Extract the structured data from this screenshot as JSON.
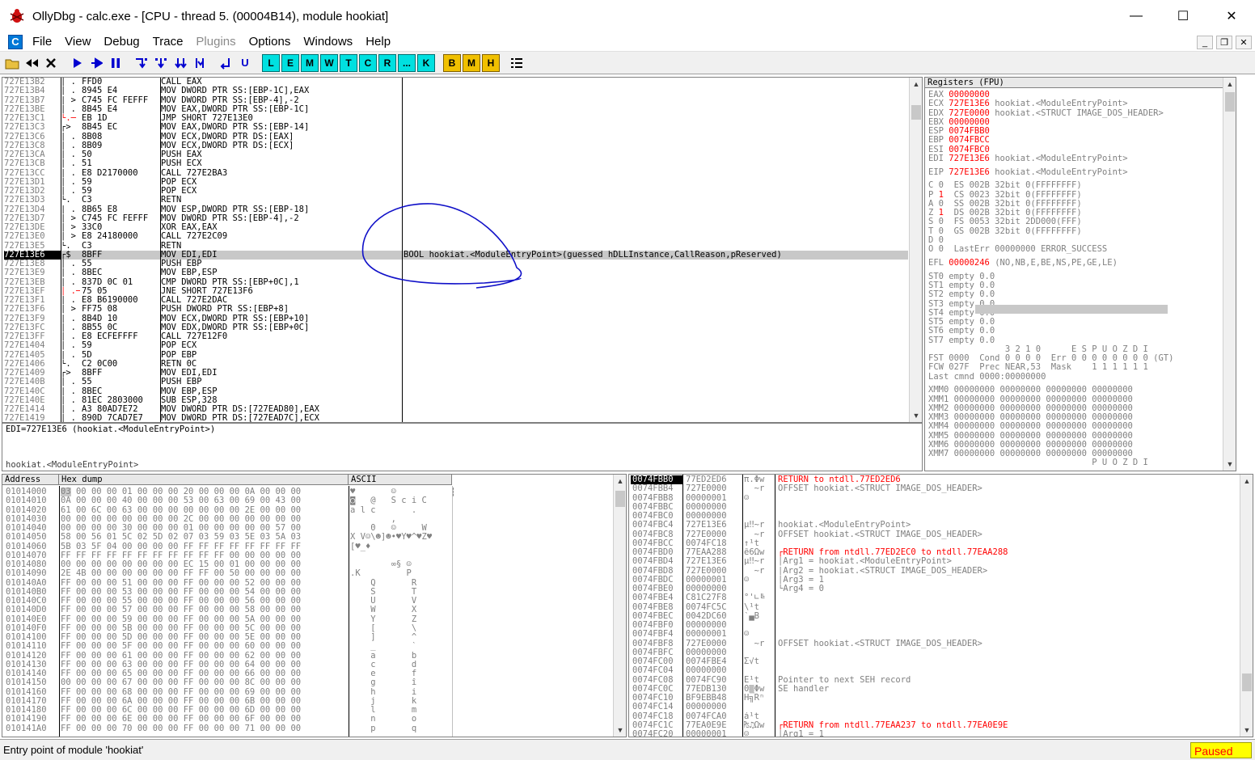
{
  "window": {
    "title": "OllyDbg - calc.exe - [CPU - thread 5. (00004B14), module hookiat]",
    "min": "—",
    "max": "☐",
    "close": "✕"
  },
  "menu": {
    "items": [
      {
        "label": "File",
        "enabled": true
      },
      {
        "label": "View",
        "enabled": true
      },
      {
        "label": "Debug",
        "enabled": true
      },
      {
        "label": "Trace",
        "enabled": true
      },
      {
        "label": "Plugins",
        "enabled": false
      },
      {
        "label": "Options",
        "enabled": true
      },
      {
        "label": "Windows",
        "enabled": true
      },
      {
        "label": "Help",
        "enabled": true
      }
    ]
  },
  "toolbar": {
    "letters": [
      "L",
      "E",
      "M",
      "W",
      "T",
      "C",
      "R",
      "...",
      "K"
    ],
    "letters2": [
      "B",
      "M",
      "H"
    ]
  },
  "disasm": {
    "selected_index": 19,
    "rows": [
      [
        "727E13B2",
        "│ .",
        "FFD0",
        "CALL EAX",
        ""
      ],
      [
        "727E13B4",
        "│ .",
        "8945 E4",
        "MOV DWORD PTR SS:[EBP-1C],EAX",
        ""
      ],
      [
        "727E13B7",
        "│ >",
        "C745 FC FEFFF",
        "MOV DWORD PTR SS:[EBP-4],-2",
        ""
      ],
      [
        "727E13BE",
        "│ .",
        "8B45 E4",
        "MOV EAX,DWORD PTR SS:[EBP-1C]",
        ""
      ],
      [
        "727E13C1",
        "└.─",
        "EB 1D",
        "JMP SHORT 727E13E0",
        ""
      ],
      [
        "727E13C3",
        "┌>",
        "8B45 EC",
        "MOV EAX,DWORD PTR SS:[EBP-14]",
        ""
      ],
      [
        "727E13C6",
        "│ .",
        "8B08",
        "MOV ECX,DWORD PTR DS:[EAX]",
        ""
      ],
      [
        "727E13C8",
        "│ .",
        "8B09",
        "MOV ECX,DWORD PTR DS:[ECX]",
        ""
      ],
      [
        "727E13CA",
        "│ .",
        "50",
        "PUSH EAX",
        ""
      ],
      [
        "727E13CB",
        "│ .",
        "51",
        "PUSH ECX",
        ""
      ],
      [
        "727E13CC",
        "│ .",
        "E8 D2170000",
        "CALL 727E2BA3",
        ""
      ],
      [
        "727E13D1",
        "│ .",
        "59",
        "POP ECX",
        ""
      ],
      [
        "727E13D2",
        "│ .",
        "59",
        "POP ECX",
        ""
      ],
      [
        "727E13D3",
        "└.",
        "C3",
        "RETN",
        ""
      ],
      [
        "727E13D4",
        "│ .",
        "8B65 E8",
        "MOV ESP,DWORD PTR SS:[EBP-18]",
        ""
      ],
      [
        "727E13D7",
        "│ >",
        "C745 FC FEFFF",
        "MOV DWORD PTR SS:[EBP-4],-2",
        ""
      ],
      [
        "727E13DE",
        "│ >",
        "33C0",
        "XOR EAX,EAX",
        ""
      ],
      [
        "727E13E0",
        "│ >",
        "E8 24180000",
        "CALL 727E2C09",
        ""
      ],
      [
        "727E13E5",
        "└.",
        "C3",
        "RETN",
        ""
      ],
      [
        "727E13E6",
        "┌$",
        "8BFF",
        "MOV EDI,EDI",
        "BOOL hookiat.<ModuleEntryPoint>(guessed hDLLInstance,CallReason,pReserved)"
      ],
      [
        "727E13E8",
        "│ .",
        "55",
        "PUSH EBP",
        ""
      ],
      [
        "727E13E9",
        "│ .",
        "8BEC",
        "MOV EBP,ESP",
        ""
      ],
      [
        "727E13EB",
        "│ .",
        "837D 0C 01",
        "CMP DWORD PTR SS:[EBP+0C],1",
        ""
      ],
      [
        "727E13EF",
        "│ .─",
        "75 05",
        "JNE SHORT 727E13F6",
        ""
      ],
      [
        "727E13F1",
        "│ .",
        "E8 B6190000",
        "CALL 727E2DAC",
        ""
      ],
      [
        "727E13F6",
        "│ >",
        "FF75 08",
        "PUSH DWORD PTR SS:[EBP+8]",
        ""
      ],
      [
        "727E13F9",
        "│ .",
        "8B4D 10",
        "MOV ECX,DWORD PTR SS:[EBP+10]",
        ""
      ],
      [
        "727E13FC",
        "│ .",
        "8B55 0C",
        "MOV EDX,DWORD PTR SS:[EBP+0C]",
        ""
      ],
      [
        "727E13FF",
        "│ .",
        "E8 ECFEFFFF",
        "CALL 727E12F0",
        ""
      ],
      [
        "727E1404",
        "│ .",
        "59",
        "POP ECX",
        ""
      ],
      [
        "727E1405",
        "│ .",
        "5D",
        "POP EBP",
        ""
      ],
      [
        "727E1406",
        "└.",
        "C2 0C00",
        "RETN 0C",
        ""
      ],
      [
        "727E1409",
        "┌>",
        "8BFF",
        "MOV EDI,EDI",
        ""
      ],
      [
        "727E140B",
        "│ .",
        "55",
        "PUSH EBP",
        ""
      ],
      [
        "727E140C",
        "│ .",
        "8BEC",
        "MOV EBP,ESP",
        ""
      ],
      [
        "727E140E",
        "│ .",
        "81EC 2803000",
        "SUB ESP,328",
        ""
      ],
      [
        "727E1414",
        "│ .",
        "A3 80AD7E72",
        "MOV DWORD PTR DS:[727EAD80],EAX",
        ""
      ],
      [
        "727E1419",
        "│ .",
        "890D 7CAD7E7",
        "MOV DWORD PTR DS:[727EAD7C],ECX",
        ""
      ]
    ]
  },
  "info": {
    "line1": "EDI=727E13E6 (hookiat.<ModuleEntryPoint>)",
    "line2": "hookiat.<ModuleEntryPoint>"
  },
  "registers": {
    "header": "Registers (FPU)",
    "lines": [
      [
        [
          "EAX ",
          "g"
        ],
        [
          "00000000",
          "r"
        ]
      ],
      [
        [
          "ECX ",
          "g"
        ],
        [
          "727E13E6",
          "r"
        ],
        [
          " hookiat.<ModuleEntryPoint>",
          "g"
        ]
      ],
      [
        [
          "EDX ",
          "g"
        ],
        [
          "727E0000",
          "r"
        ],
        [
          " hookiat.<STRUCT IMAGE_DOS_HEADER>",
          "g"
        ]
      ],
      [
        [
          "EBX ",
          "g"
        ],
        [
          "00000000",
          "r"
        ]
      ],
      [
        [
          "ESP ",
          "g"
        ],
        [
          "0074FBB0",
          "r"
        ]
      ],
      [
        [
          "EBP ",
          "g"
        ],
        [
          "0074FBCC",
          "r"
        ]
      ],
      [
        [
          "ESI ",
          "g"
        ],
        [
          "0074FBC0",
          "r"
        ]
      ],
      [
        [
          "EDI ",
          "g"
        ],
        [
          "727E13E6",
          "r"
        ],
        [
          " hookiat.<ModuleEntryPoint>",
          "g"
        ]
      ],
      [
        [
          "",
          "g"
        ]
      ],
      [
        [
          "EIP ",
          "g"
        ],
        [
          "727E13E6",
          "r"
        ],
        [
          " hookiat.<ModuleEntryPoint>",
          "g"
        ]
      ],
      [
        [
          "",
          "g"
        ]
      ],
      [
        [
          "C 0  ES 002B 32bit 0(FFFFFFFF)",
          "g"
        ]
      ],
      [
        [
          "P ",
          "g"
        ],
        [
          "1",
          "r"
        ],
        [
          "  CS 0023 32bit 0(FFFFFFFF)",
          "g"
        ]
      ],
      [
        [
          "A 0  SS 002B 32bit 0(FFFFFFFF)",
          "g"
        ]
      ],
      [
        [
          "Z ",
          "g"
        ],
        [
          "1",
          "r"
        ],
        [
          "  DS 002B 32bit 0(FFFFFFFF)",
          "g"
        ]
      ],
      [
        [
          "S 0  FS 0053 32bit 2DD000(FFF)",
          "g"
        ]
      ],
      [
        [
          "T 0  GS 002B 32bit 0(FFFFFFFF)",
          "g"
        ]
      ],
      [
        [
          "D 0",
          "g"
        ]
      ],
      [
        [
          "O 0  LastErr 00000000 ERROR_SUCCESS",
          "g"
        ]
      ],
      [
        [
          "",
          "g"
        ]
      ],
      [
        [
          "EFL ",
          "g"
        ],
        [
          "00000246",
          "r"
        ],
        [
          " (NO,NB,E,BE,NS,PE,GE,LE)",
          "g"
        ]
      ],
      [
        [
          "",
          "g"
        ]
      ],
      [
        [
          "ST0 empty 0.0",
          "g"
        ]
      ],
      [
        [
          "ST1 empty 0.0",
          "g"
        ]
      ],
      [
        [
          "ST2 empty 0.0",
          "g"
        ]
      ],
      [
        [
          "ST3 empty 0.0",
          "g"
        ]
      ],
      [
        [
          "ST4 empty 0.0",
          "g"
        ]
      ],
      [
        [
          "ST5 empty 0.0",
          "g"
        ]
      ],
      [
        [
          "ST6 empty 0.0",
          "g"
        ]
      ],
      [
        [
          "ST7 empty 0.0",
          "g"
        ]
      ],
      [
        [
          "               3 2 1 0      E S P U O Z D I",
          "g"
        ]
      ],
      [
        [
          "FST 0000  Cond 0 0 0 0  Err 0 0 0 0 0 0 0 0 (GT)",
          "g"
        ]
      ],
      [
        [
          "FCW 027F  Prec NEAR,53  Mask    1 1 1 1 1 1",
          "g"
        ]
      ],
      [
        [
          "Last cmnd 0000:00000000",
          "g"
        ]
      ],
      [
        [
          "",
          "g"
        ]
      ],
      [
        [
          "XMM0 00000000 00000000 00000000 00000000",
          "g"
        ]
      ],
      [
        [
          "XMM1 00000000 00000000 00000000 00000000",
          "g"
        ]
      ],
      [
        [
          "XMM2 00000000 00000000 00000000 00000000",
          "g"
        ]
      ],
      [
        [
          "XMM3 00000000 00000000 00000000 00000000",
          "g"
        ]
      ],
      [
        [
          "XMM4 00000000 00000000 00000000 00000000",
          "g"
        ]
      ],
      [
        [
          "XMM5 00000000 00000000 00000000 00000000",
          "g"
        ]
      ],
      [
        [
          "XMM6 00000000 00000000 00000000 00000000",
          "g"
        ]
      ],
      [
        [
          "XMM7 00000000 00000000 00000000 00000000",
          "g"
        ]
      ],
      [
        [
          "                                P U O Z D I",
          "g"
        ]
      ]
    ]
  },
  "dump": {
    "headers": [
      "Address",
      "Hex dump",
      "ASCII"
    ],
    "rows": [
      [
        "01014000",
        "03 00 00 00 01 00 00 00 20 00 00 00 0A 00 00 00",
        "♥       ☺           ◙   "
      ],
      [
        "01014010",
        "0A 00 00 00 40 00 00 00 53 00 63 00 69 00 43 00",
        "◙   @   S c i C "
      ],
      [
        "01014020",
        "61 00 6C 00 63 00 00 00 00 00 00 00 2E 00 00 00",
        "a l c       .   "
      ],
      [
        "01014030",
        "00 00 00 00 00 00 00 00 2C 00 00 00 00 00 00 00",
        "        ,       "
      ],
      [
        "01014040",
        "00 00 00 00 30 00 00 00 01 00 00 00 00 00 57 00",
        "    0   ☺     W "
      ],
      [
        "01014050",
        "58 00 56 01 5C 02 5D 02 07 03 59 03 5E 03 5A 03",
        "X V☺\\☻]☻•♥Y♥^♥Z♥"
      ],
      [
        "01014060",
        "5B 03 5F 04 00 00 00 00 FF FF FF FF FF FF FF FF",
        "[♥_♦        "
      ],
      [
        "01014070",
        "FF FF FF FF FF FF FF FF FF FF FF 00 00 00 00 00",
        "                "
      ],
      [
        "01014080",
        "00 00 00 00 00 00 00 00 EC 15 00 01 00 00 00 00",
        "        ∞§ ☺    "
      ],
      [
        "01014090",
        "2E 4B 00 00 00 00 00 00 FF FF 00 50 00 00 00 00",
        ".K         P    "
      ],
      [
        "010140A0",
        "FF 00 00 00 51 00 00 00 FF 00 00 00 52 00 00 00",
        "    Q       R   "
      ],
      [
        "010140B0",
        "FF 00 00 00 53 00 00 00 FF 00 00 00 54 00 00 00",
        "    S       T   "
      ],
      [
        "010140C0",
        "FF 00 00 00 55 00 00 00 FF 00 00 00 56 00 00 00",
        "    U       V   "
      ],
      [
        "010140D0",
        "FF 00 00 00 57 00 00 00 FF 00 00 00 58 00 00 00",
        "    W       X   "
      ],
      [
        "010140E0",
        "FF 00 00 00 59 00 00 00 FF 00 00 00 5A 00 00 00",
        "    Y       Z   "
      ],
      [
        "010140F0",
        "FF 00 00 00 5B 00 00 00 FF 00 00 00 5C 00 00 00",
        "    [       \\   "
      ],
      [
        "01014100",
        "FF 00 00 00 5D 00 00 00 FF 00 00 00 5E 00 00 00",
        "    ]       ^   "
      ],
      [
        "01014110",
        "FF 00 00 00 5F 00 00 00 FF 00 00 00 60 00 00 00",
        "    _       `   "
      ],
      [
        "01014120",
        "FF 00 00 00 61 00 00 00 FF 00 00 00 62 00 00 00",
        "    a       b   "
      ],
      [
        "01014130",
        "FF 00 00 00 63 00 00 00 FF 00 00 00 64 00 00 00",
        "    c       d   "
      ],
      [
        "01014140",
        "FF 00 00 00 65 00 00 00 FF 00 00 00 66 00 00 00",
        "    e       f   "
      ],
      [
        "01014150",
        "00 00 00 00 67 00 00 00 FF 00 00 00 8C 00 00 00",
        "    g       î   "
      ],
      [
        "01014160",
        "FF 00 00 00 68 00 00 00 FF 00 00 00 69 00 00 00",
        "    h       i   "
      ],
      [
        "01014170",
        "FF 00 00 00 6A 00 00 00 FF 00 00 00 6B 00 00 00",
        "    j       k   "
      ],
      [
        "01014180",
        "FF 00 00 00 6C 00 00 00 FF 00 00 00 6D 00 00 00",
        "    l       m   "
      ],
      [
        "01014190",
        "FF 00 00 00 6E 00 00 00 FF 00 00 00 6F 00 00 00",
        "    n       o   "
      ],
      [
        "010141A0",
        "FF 00 00 00 70 00 00 00 FF 00 00 00 71 00 00 00",
        "    p       q   "
      ]
    ]
  },
  "stack": {
    "rows": [
      [
        "0074FBB0",
        "77ED2ED6",
        "π.Φw",
        "RETURN to ntdll.77ED2ED6",
        "r"
      ],
      [
        "0074FBB4",
        "727E0000",
        "  ~r",
        "OFFSET hookiat.<STRUCT IMAGE_DOS_HEADER>",
        "g"
      ],
      [
        "0074FBB8",
        "00000001",
        "☺",
        "",
        ""
      ],
      [
        "0074FBBC",
        "00000000",
        "",
        "",
        ""
      ],
      [
        "0074FBC0",
        "00000000",
        "",
        "",
        ""
      ],
      [
        "0074FBC4",
        "727E13E6",
        "μ‼~r",
        "hookiat.<ModuleEntryPoint>",
        "g"
      ],
      [
        "0074FBC8",
        "727E0000",
        "  ~r",
        "OFFSET hookiat.<STRUCT IMAGE_DOS_HEADER>",
        "g"
      ],
      [
        "0074FBCC",
        "0074FC18",
        "↑¹t",
        "",
        ""
      ],
      [
        "0074FBD0",
        "77EAA288",
        "ê6Ωw",
        "┌RETURN from ntdll.77ED2EC0 to ntdll.77EAA288",
        "r"
      ],
      [
        "0074FBD4",
        "727E13E6",
        "μ‼~r",
        "│Arg1 = hookiat.<ModuleEntryPoint>",
        "g"
      ],
      [
        "0074FBD8",
        "727E0000",
        "  ~r",
        "│Arg2 = hookiat.<STRUCT IMAGE_DOS_HEADER>",
        "g"
      ],
      [
        "0074FBDC",
        "00000001",
        "☺",
        "│Arg3 = 1",
        "g"
      ],
      [
        "0074FBE0",
        "00000000",
        "",
        "└Arg4 = 0",
        "g"
      ],
      [
        "0074FBE4",
        "C81C27F8",
        "°'∟╚",
        "",
        ""
      ],
      [
        "0074FBE8",
        "0074FC5C",
        "\\¹t",
        "",
        ""
      ],
      [
        "0074FBEC",
        "0042DC60",
        "`▄B",
        "",
        ""
      ],
      [
        "0074FBF0",
        "00000000",
        "",
        "",
        ""
      ],
      [
        "0074FBF4",
        "00000001",
        "☺",
        "",
        ""
      ],
      [
        "0074FBF8",
        "727E0000",
        "  ~r",
        "OFFSET hookiat.<STRUCT IMAGE_DOS_HEADER>",
        "g"
      ],
      [
        "0074FBFC",
        "00000000",
        "",
        "",
        ""
      ],
      [
        "0074FC00",
        "0074FBE4",
        "Σ√t",
        "",
        ""
      ],
      [
        "0074FC04",
        "00000000",
        "",
        "",
        ""
      ],
      [
        "0074FC08",
        "0074FC90",
        "É¹t",
        "Pointer to next SEH record",
        "g"
      ],
      [
        "0074FC0C",
        "77EDB130",
        "0▒Φw",
        "SE handler",
        "g"
      ],
      [
        "0074FC10",
        "BF9EBB48",
        "H╗Rⁿ",
        "",
        ""
      ],
      [
        "0074FC14",
        "00000000",
        "",
        "",
        ""
      ],
      [
        "0074FC18",
        "0074FCA0",
        "á¹t",
        "",
        ""
      ],
      [
        "0074FC1C",
        "77EA0E9E",
        "₧♫Ωw",
        "┌RETURN from ntdll.77EAA237 to ntdll.77EA0E9E",
        "r"
      ],
      [
        "0074FC20",
        "00000001",
        "☺",
        "│Arg1 = 1",
        "g"
      ]
    ]
  },
  "status": {
    "text": "Entry point of module 'hookiat'",
    "state": "Paused"
  },
  "colors": {
    "accent": "#0000d0",
    "paused_bg": "#ffff00",
    "paused_fg": "#ff0000",
    "annotation": "#1010c8"
  }
}
